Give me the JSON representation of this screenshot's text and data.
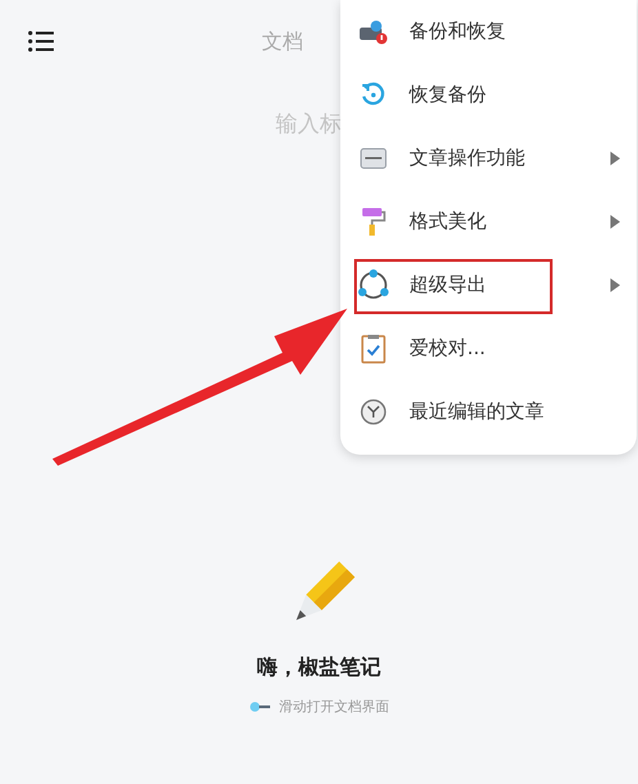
{
  "header": {
    "tab": "文档"
  },
  "editor": {
    "placeholder": "输入标"
  },
  "empty_state": {
    "title": "嗨，椒盐笔记",
    "hint": "滑动打开文档界面"
  },
  "menu": {
    "items": [
      {
        "label": "备份和恢复",
        "kind": "cloud",
        "submenu": false,
        "annotated": false
      },
      {
        "label": "恢复备份",
        "kind": "restore",
        "submenu": false,
        "annotated": false
      },
      {
        "label": "文章操作功能",
        "kind": "ctrl",
        "submenu": true,
        "annotated": false
      },
      {
        "label": "格式美化",
        "kind": "roller",
        "submenu": true,
        "annotated": false
      },
      {
        "label": "超级导出",
        "kind": "share",
        "submenu": true,
        "annotated": true
      },
      {
        "label": "爱校对...",
        "kind": "clipboard",
        "submenu": false,
        "annotated": false
      },
      {
        "label": "最近编辑的文章",
        "kind": "clock",
        "submenu": false,
        "annotated": false
      }
    ]
  }
}
